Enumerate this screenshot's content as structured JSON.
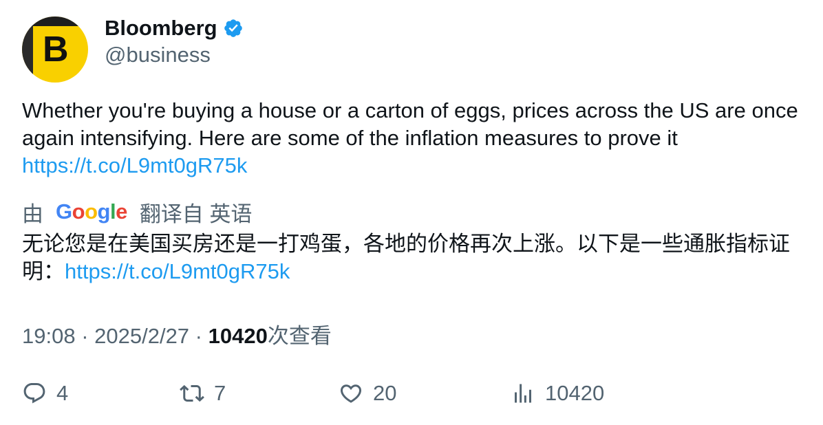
{
  "author": {
    "avatar_letter": "B",
    "display_name": "Bloomberg",
    "handle": "@business"
  },
  "tweet": {
    "text_line1": "Whether you're buying a house or a carton of eggs, prices across the US are once again intensifying. Here are some of the inflation measures to prove it",
    "link": "https://t.co/L9mt0gR75k"
  },
  "translation": {
    "prefix": "由",
    "provider": "Google",
    "suffix": "翻译自 英语",
    "text": "无论您是在美国买房还是一打鸡蛋，各地的价格再次上涨。以下是一些通胀指标证明：",
    "link": "https://t.co/L9mt0gR75k"
  },
  "meta": {
    "time": "19:08",
    "separator1": " · ",
    "date": "2025/2/27",
    "separator2": " · ",
    "views_count": "10420",
    "views_label": "次查看"
  },
  "actions": {
    "replies": "4",
    "retweets": "7",
    "likes": "20",
    "views": "10420"
  },
  "colors": {
    "link": "#1d9bf0",
    "secondary_text": "#536471",
    "primary_text": "#0f1419",
    "avatar_bg": "#f9d000"
  },
  "icons": [
    "verified-badge-icon",
    "reply-icon",
    "retweet-icon",
    "like-icon",
    "views-icon"
  ]
}
